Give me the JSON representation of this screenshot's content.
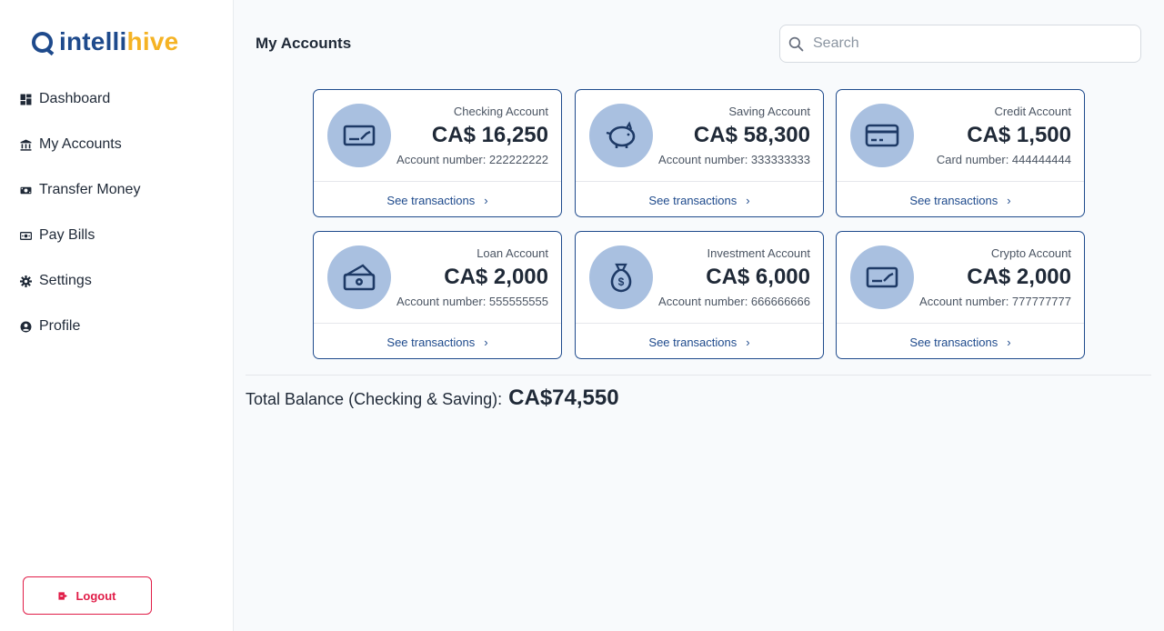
{
  "brand": {
    "part1": "intelli",
    "part2": "hive"
  },
  "sidebar": {
    "items": [
      {
        "label": "Dashboard",
        "icon": "dashboard-icon"
      },
      {
        "label": "My Accounts",
        "icon": "bank-icon"
      },
      {
        "label": "Transfer Money",
        "icon": "money-transfer-icon"
      },
      {
        "label": "Pay Bills",
        "icon": "bills-icon"
      },
      {
        "label": "Settings",
        "icon": "gear-icon"
      },
      {
        "label": "Profile",
        "icon": "user-circle-icon"
      }
    ],
    "logout_label": "Logout"
  },
  "header": {
    "title": "My Accounts",
    "search_placeholder": "Search"
  },
  "accounts": [
    {
      "type": "Checking Account",
      "amount": "CA$ 16,250",
      "number": "Account number: 222222222",
      "link": "See transactions",
      "icon": "check-card-icon"
    },
    {
      "type": "Saving Account",
      "amount": "CA$ 58,300",
      "number": "Account number: 333333333",
      "link": "See transactions",
      "icon": "piggy-bank-icon"
    },
    {
      "type": "Credit Account",
      "amount": "CA$ 1,500",
      "number": "Card number: 444444444",
      "link": "See transactions",
      "icon": "credit-card-icon"
    },
    {
      "type": "Loan Account",
      "amount": "CA$ 2,000",
      "number": "Account number: 555555555",
      "link": "See transactions",
      "icon": "cash-hand-icon"
    },
    {
      "type": "Investment Account",
      "amount": "CA$ 6,000",
      "number": "Account number: 666666666",
      "link": "See transactions",
      "icon": "money-bag-icon"
    },
    {
      "type": "Crypto Account",
      "amount": "CA$ 2,000",
      "number": "Account number: 777777777",
      "link": "See transactions",
      "icon": "check-card-icon"
    }
  ],
  "total": {
    "label": "Total Balance (Checking & Saving):",
    "value": "CA$74,550"
  },
  "colors": {
    "brand_blue": "#1e4a8c",
    "brand_yellow": "#f5b324",
    "icon_bg": "#a9c0e0",
    "logout_red": "#e11d48"
  }
}
